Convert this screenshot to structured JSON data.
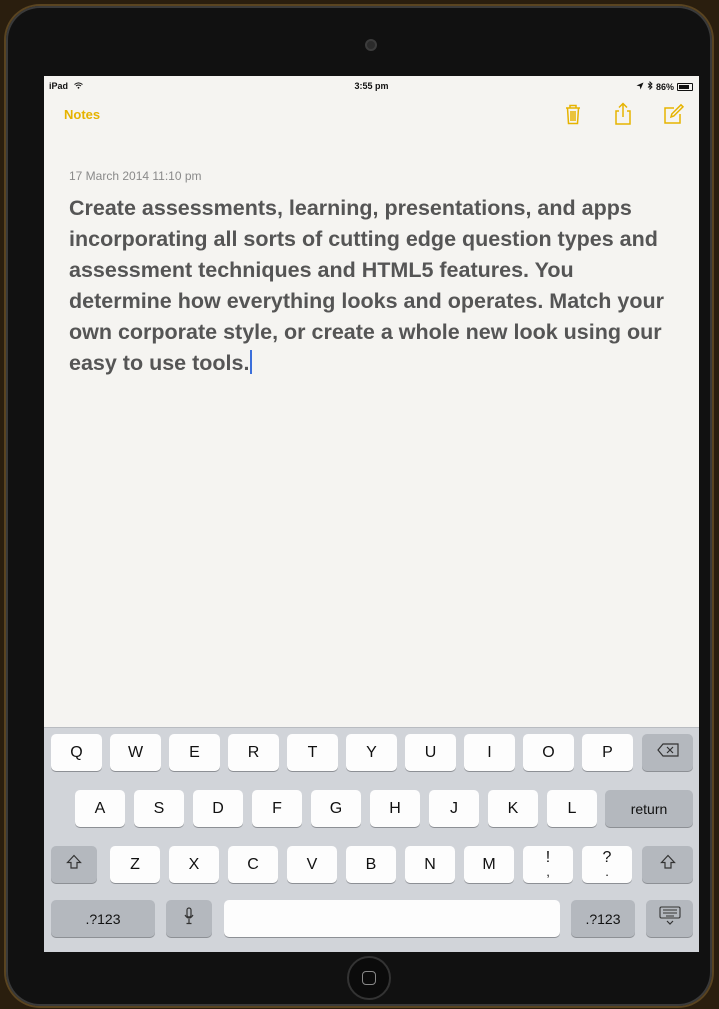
{
  "status": {
    "left": "iPad",
    "time": "3:55 pm",
    "battery": "86%",
    "battery_fraction": 0.86
  },
  "nav": {
    "back_label": "Notes",
    "accent": "#e6b300",
    "icons": [
      "trash-icon",
      "share-icon",
      "compose-icon"
    ]
  },
  "note": {
    "date": "17 March 2014 11:10 pm",
    "text": "Create assessments, learning, presentations, and apps incorporating all sorts of cutting edge question types and assessment techniques and HTML5 features. You determine how everything looks and operates. Match your own corporate style, or create a whole new look using our easy to use tools."
  },
  "keyboard": {
    "row1": [
      "Q",
      "W",
      "E",
      "R",
      "T",
      "Y",
      "U",
      "I",
      "O",
      "P"
    ],
    "row2": [
      "A",
      "S",
      "D",
      "F",
      "G",
      "H",
      "J",
      "K",
      "L"
    ],
    "row3": [
      "Z",
      "X",
      "C",
      "V",
      "B",
      "N",
      "M",
      "!",
      ",",
      "?",
      "."
    ],
    "return_label": "return",
    "numbers_label": ".?123",
    "icons": [
      "backspace-icon",
      "shift-icon",
      "microphone-icon",
      "hide-keyboard-icon"
    ]
  }
}
